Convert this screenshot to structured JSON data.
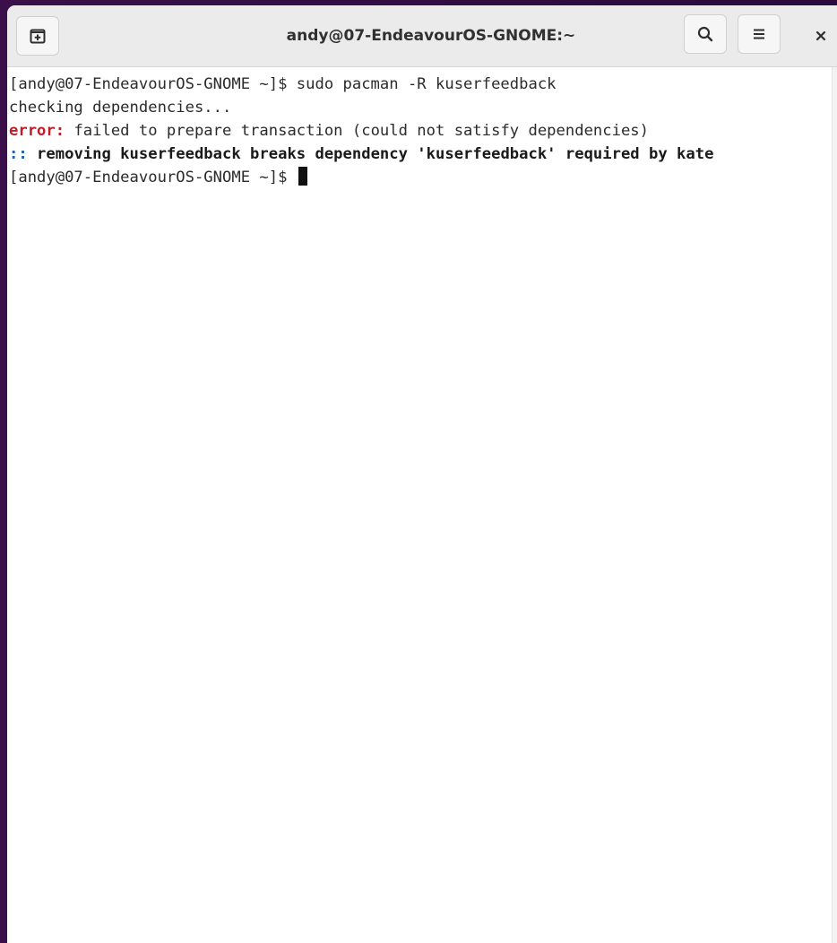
{
  "window": {
    "title": "andy@07-EndeavourOS-GNOME:~"
  },
  "headerbar": {
    "new_tab_icon": "new-tab-icon",
    "search_icon": "search-icon",
    "menu_icon": "hamburger-menu-icon",
    "close_icon": "close-icon"
  },
  "terminal": {
    "lines": [
      {
        "text": "[andy@07-EndeavourOS-GNOME ~]$ sudo pacman -R kuserfeedback"
      },
      {
        "text": "checking dependencies..."
      },
      {
        "prefix": "error:",
        "text": " failed to prepare transaction (could not satisfy dependencies)"
      },
      {
        "prefix": "::",
        "text": " removing kuserfeedback breaks dependency 'kuserfeedback' required by kate"
      },
      {
        "text": "[andy@07-EndeavourOS-GNOME ~]$ "
      }
    ]
  },
  "colors": {
    "error": "#c01c28",
    "info_prefix": "#1a5fb4",
    "background": "#ffffff",
    "headerbar": "#ebebeb"
  }
}
